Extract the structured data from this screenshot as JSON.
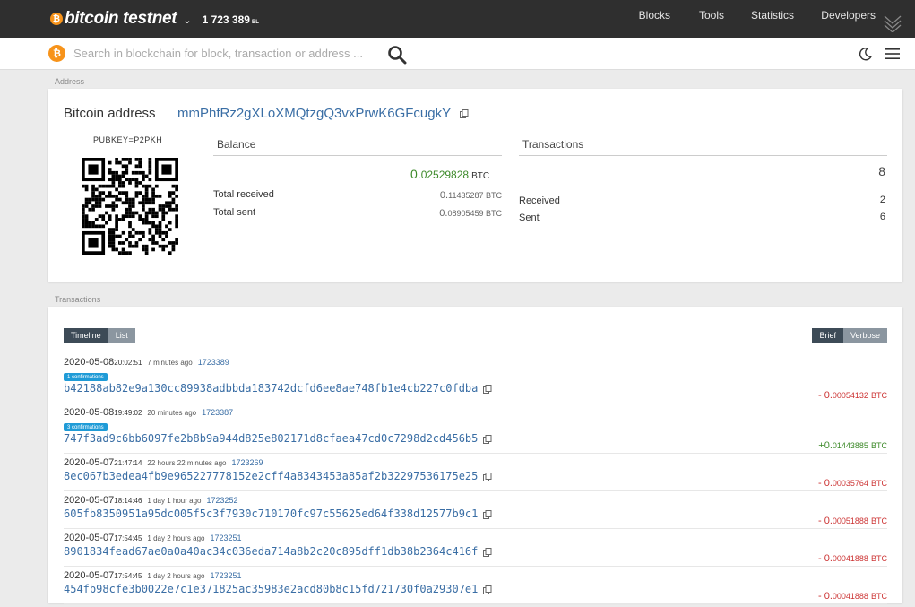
{
  "header": {
    "logo_symbol": "₿",
    "brand": "bitcoin testnet",
    "brand_chevron": "⌄",
    "block_height": "1 723 389",
    "block_height_unit": "BL",
    "nav": {
      "blocks": "Blocks",
      "tools": "Tools",
      "statistics": "Statistics",
      "developers": "Developers"
    }
  },
  "search": {
    "coin_symbol": "₿",
    "placeholder": "Search in blockchain for block, transaction or address ..."
  },
  "address_section": {
    "label": "Address",
    "title": "Bitcoin address",
    "address": "mmPhfRz2gXLoXMQtzgQ3vxPrwK6GFcugkY",
    "type": "PUBKEY=P2PKH",
    "balance": {
      "header": "Balance",
      "main_prefix": "0.",
      "main_digits": "02529828",
      "unit": "BTC",
      "total_received_label": "Total received",
      "total_received_prefix": "0.",
      "total_received_digits": "11435287",
      "total_received_unit": "BTC",
      "total_sent_label": "Total sent",
      "total_sent_prefix": "0.",
      "total_sent_digits": "08905459",
      "total_sent_unit": "BTC"
    },
    "transactions_summary": {
      "header": "Transactions",
      "total": "8",
      "received_label": "Received",
      "received": "2",
      "sent_label": "Sent",
      "sent": "6"
    }
  },
  "transactions_section": {
    "label": "Transactions",
    "view_toggle": [
      "Timeline",
      "List"
    ],
    "detail_toggle": [
      "Brief",
      "Verbose"
    ],
    "items": [
      {
        "date": "2020-05-08",
        "time": "20:02:51",
        "ago": "7 minutes ago",
        "block": "1723389",
        "badge": "1 confirmations",
        "hash": "b42188ab82e9a130cc89938adbbda183742dcfd6ee8ae748fb1e4cb227c0fdba",
        "sign": "- ",
        "amt_prefix": "0.",
        "amt_digits": "00054132",
        "unit": "BTC",
        "direction": "out"
      },
      {
        "date": "2020-05-08",
        "time": "19:49:02",
        "ago": "20 minutes ago",
        "block": "1723387",
        "badge": "3 confirmations",
        "hash": "747f3ad9c6bb6097fe2b8b9a944d825e802171d8cfaea47cd0c7298d2cd456b5",
        "sign": "+",
        "amt_prefix": "0.",
        "amt_digits": "01443885",
        "unit": "BTC",
        "direction": "in"
      },
      {
        "date": "2020-05-07",
        "time": "21:47:14",
        "ago": "22 hours 22 minutes ago",
        "block": "1723269",
        "badge": "",
        "hash": "8ec067b3edea4fb9e965227778152e2cff4a8343453a85af2b32297536175e25",
        "sign": "- ",
        "amt_prefix": "0.",
        "amt_digits": "00035764",
        "unit": "BTC",
        "direction": "out"
      },
      {
        "date": "2020-05-07",
        "time": "18:14:46",
        "ago": "1 day 1 hour ago",
        "block": "1723252",
        "badge": "",
        "hash": "605fb8350951a95dc005f5c3f7930c710170fc97c55625ed64f338d12577b9c1",
        "sign": "- ",
        "amt_prefix": "0.",
        "amt_digits": "00051888",
        "unit": "BTC",
        "direction": "out"
      },
      {
        "date": "2020-05-07",
        "time": "17:54:45",
        "ago": "1 day 2 hours ago",
        "block": "1723251",
        "badge": "",
        "hash": "8901834fead67ae0a0a40ac34c036eda714a8b2c20c895dff1db38b2364c416f",
        "sign": "- ",
        "amt_prefix": "0.",
        "amt_digits": "00041888",
        "unit": "BTC",
        "direction": "out"
      },
      {
        "date": "2020-05-07",
        "time": "17:54:45",
        "ago": "1 day 2 hours ago",
        "block": "1723251",
        "badge": "",
        "hash": "454fb98cfe3b0022e7c1e371825ac35983e2acd80b8c15fd721730f0a29307e1",
        "sign": "- ",
        "amt_prefix": "0.",
        "amt_digits": "00041888",
        "unit": "BTC",
        "direction": "out"
      }
    ]
  },
  "colors": {
    "accent_orange": "#f7931a",
    "link_blue": "#3a6ea5",
    "positive_green": "#3d8a2a",
    "negative_red": "#cc3333",
    "badge_blue": "#1f9bd7",
    "topbar_bg": "#2f2f2f"
  }
}
